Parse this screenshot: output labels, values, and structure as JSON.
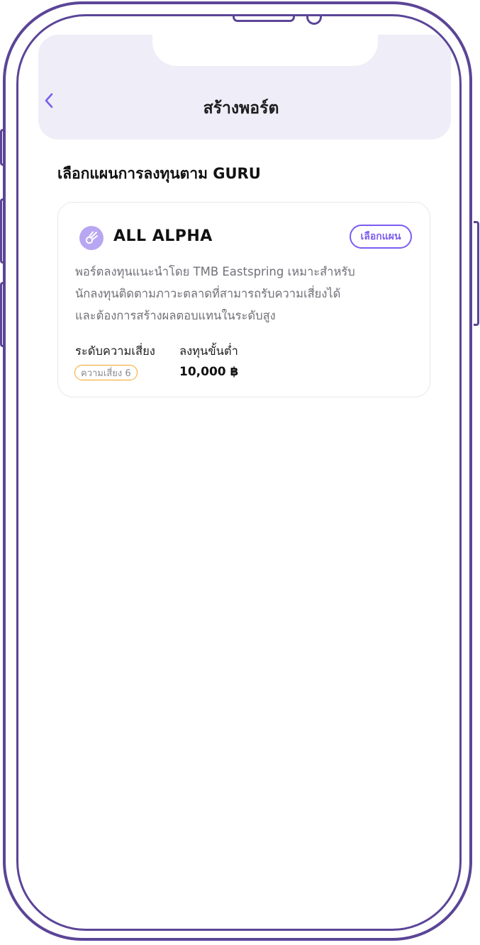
{
  "header": {
    "title": "สร้างพอร์ต"
  },
  "section": {
    "title": "เลือกแผนการลงทุนตาม GURU"
  },
  "plan": {
    "name": "ALL ALPHA",
    "select_label": "เลือกแผน",
    "description_lines": [
      "พอร์ตลงทุนแนะนำโดย TMB Eastspring เหมาะสำหรับ",
      "นักลงทุนติดตามภาวะตลาดที่สามารถรับความเสี่ยงได้",
      "และต้องการสร้างผลตอบแทนในระดับสูง"
    ],
    "risk_label": "ระดับความเสี่ยง",
    "risk_value": "ความเสี่ยง 6",
    "min_invest_label": "ลงทุนขั้นต่ำ",
    "min_invest_value": "10,000 ฿"
  },
  "colors": {
    "frame": "#5b4597",
    "header_bg": "#efedf7",
    "accent": "#7b5cf0",
    "risk_border": "#f5a623"
  },
  "icons": {
    "back": "chevron-left-icon",
    "plan": "comet-icon"
  }
}
